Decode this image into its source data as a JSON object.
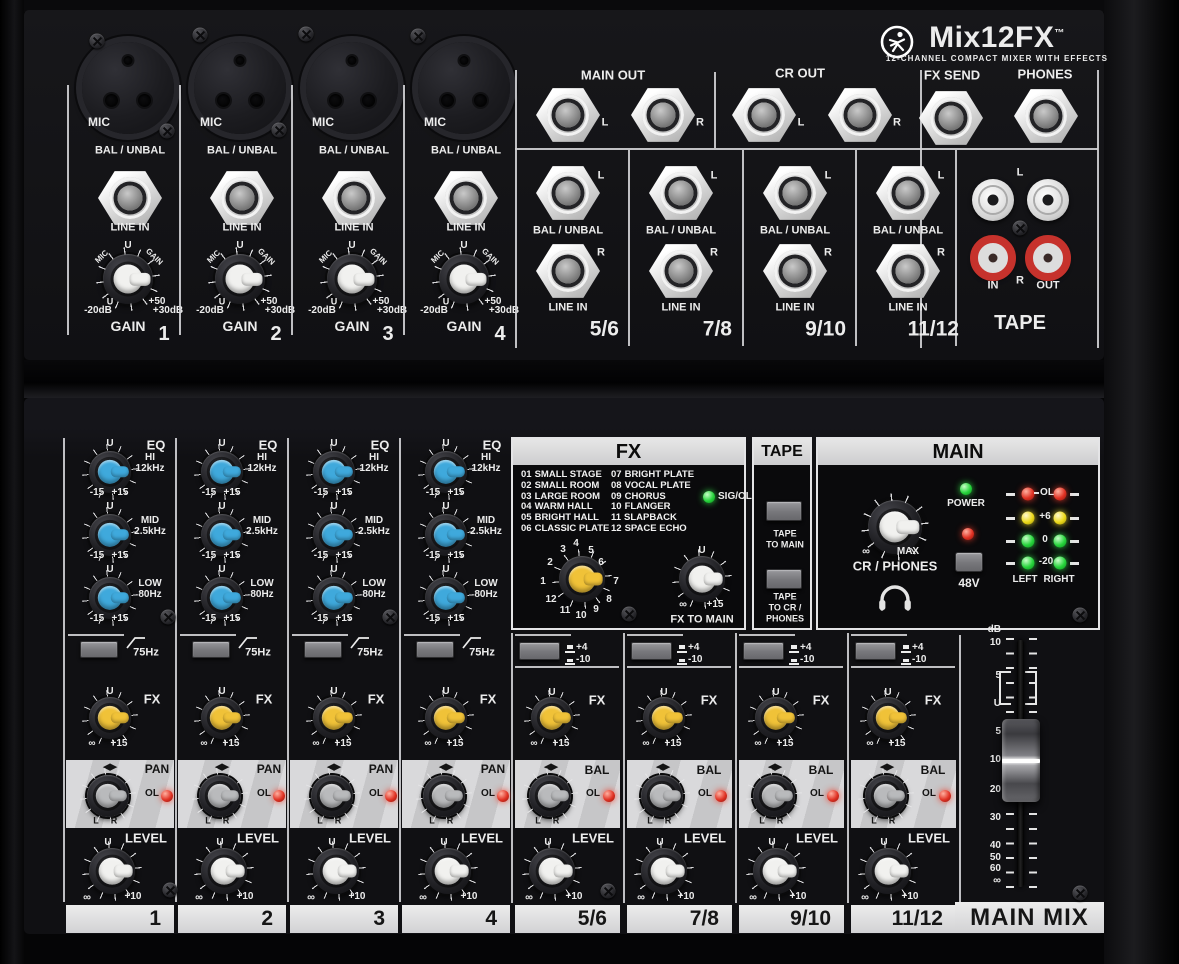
{
  "brand": {
    "model": "Mix12FX",
    "tm": "™",
    "tagline": "12-CHANNEL COMPACT MIXER WITH EFFECTS"
  },
  "top_io": {
    "mic": "MIC",
    "bal_unbal": "BAL / UNBAL",
    "line_in": "LINE IN",
    "gain": {
      "unity": "U",
      "arc_word1": "MIC",
      "arc_word2": "GAIN",
      "left_unity": "U",
      "line_min": "-20dB",
      "mic_max": "+50",
      "line_max": "+30dB",
      "label": "GAIN"
    },
    "mono_numbers": [
      "1",
      "2",
      "3",
      "4"
    ],
    "main_out": "MAIN OUT",
    "cr_out": "CR OUT",
    "fx_send": "FX SEND",
    "phones": "PHONES",
    "l": "L",
    "r": "R",
    "stereo_numbers": [
      "5/6",
      "7/8",
      "9/10",
      "11/12"
    ],
    "tape": {
      "label": "TAPE",
      "l": "L",
      "r": "R",
      "in": "IN",
      "out": "OUT"
    }
  },
  "strip": {
    "eq": {
      "label": "EQ",
      "hi": "HI",
      "hi_freq": "12kHz",
      "mid": "MID",
      "mid_freq": "2.5kHz",
      "low": "LOW",
      "low_freq": "80Hz",
      "min": "-15",
      "max": "+15",
      "unity": "U"
    },
    "lowcut": "75Hz",
    "pad": {
      "plus": "+4",
      "minus": "-10"
    },
    "fx": {
      "label": "FX",
      "unity": "U",
      "min": "∞",
      "max": "+15"
    },
    "pan": {
      "label": "PAN",
      "bal": "BAL",
      "ol": "OL",
      "l": "L",
      "r": "R",
      "arrows": "◀▶"
    },
    "level": {
      "label": "LEVEL",
      "unity": "U",
      "min": "∞",
      "max": "+10"
    }
  },
  "fx_section": {
    "title": "FX",
    "presets": [
      {
        "n": "01",
        "name": "SMALL STAGE"
      },
      {
        "n": "02",
        "name": "SMALL ROOM"
      },
      {
        "n": "03",
        "name": "LARGE ROOM"
      },
      {
        "n": "04",
        "name": "WARM HALL"
      },
      {
        "n": "05",
        "name": "BRIGHT HALL"
      },
      {
        "n": "06",
        "name": "CLASSIC PLATE"
      },
      {
        "n": "07",
        "name": "BRIGHT PLATE"
      },
      {
        "n": "08",
        "name": "VOCAL PLATE"
      },
      {
        "n": "09",
        "name": "CHORUS"
      },
      {
        "n": "10",
        "name": "FLANGER"
      },
      {
        "n": "11",
        "name": "SLAPBACK"
      },
      {
        "n": "12",
        "name": "SPACE ECHO"
      }
    ],
    "sig_ol": "SIG/OL",
    "dial": [
      "1",
      "2",
      "3",
      "4",
      "5",
      "6",
      "7",
      "8",
      "9",
      "10",
      "11",
      "12"
    ],
    "to_main": {
      "unity": "U",
      "min": "∞",
      "max": "+15",
      "label": "FX TO MAIN"
    }
  },
  "tape_section": {
    "title": "TAPE",
    "to_main": [
      "TAPE",
      "TO MAIN"
    ],
    "to_cr": [
      "TAPE",
      "TO CR /",
      "PHONES"
    ]
  },
  "main_section": {
    "title": "MAIN",
    "power": "POWER",
    "phantom": "48V",
    "cr_phones": {
      "min": "∞",
      "max": "MAX",
      "label": "CR / PHONES"
    },
    "meter": {
      "ol": "OL",
      "plus6": "+6",
      "zero": "0",
      "minus20": "-20",
      "left": "LEFT",
      "right": "RIGHT"
    },
    "fader": {
      "db": "dB",
      "scale": [
        "10",
        "5",
        "U",
        "5",
        "10",
        "20",
        "30",
        "40",
        "50",
        "60",
        "∞"
      ],
      "label": "MAIN MIX"
    }
  },
  "colors": {
    "eq_knob": "#3fa9dc",
    "fx_knob": "#f0c238",
    "level_knob": "#f1f1ef",
    "pan_knob": "#b9babc",
    "led_green": "#27d43c",
    "led_red": "#e03224",
    "led_yellow": "#ecd91a",
    "panel_dark": "#101013",
    "panel_light": "#d8d8da"
  }
}
